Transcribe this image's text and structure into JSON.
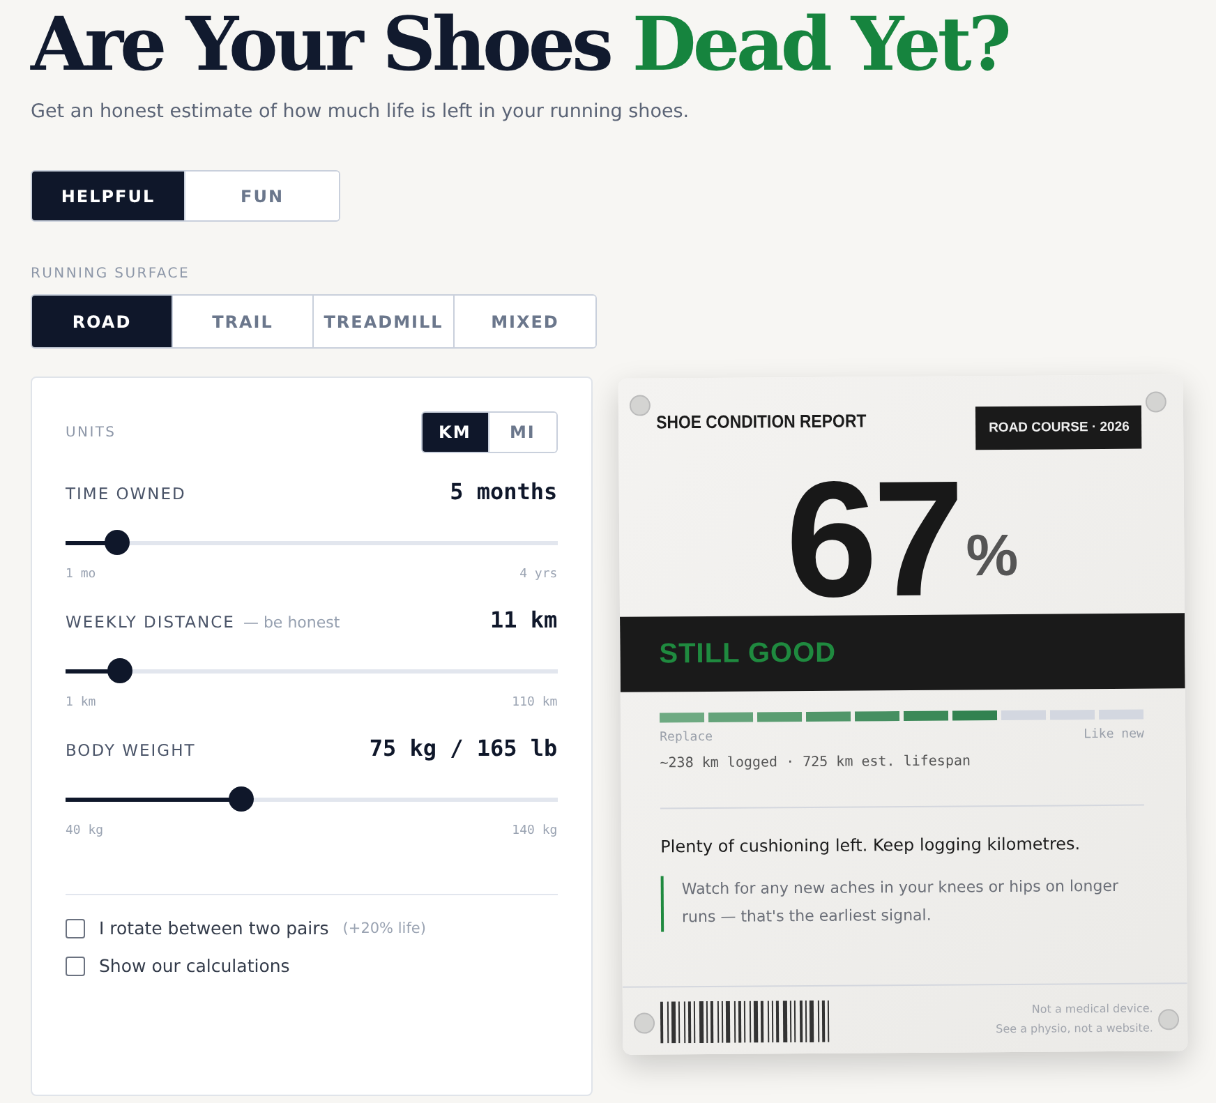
{
  "title": {
    "main": "Are Your Shoes",
    "accent": "Dead Yet?"
  },
  "subtitle": "Get an honest estimate of how much life is left in your running shoes.",
  "modes": [
    {
      "label": "HELPFUL",
      "selected": true
    },
    {
      "label": "FUN",
      "selected": false
    }
  ],
  "surface": {
    "label": "RUNNING SURFACE",
    "options": [
      {
        "label": "ROAD",
        "selected": true
      },
      {
        "label": "TRAIL",
        "selected": false
      },
      {
        "label": "TREADMILL",
        "selected": false
      },
      {
        "label": "MIXED",
        "selected": false
      }
    ]
  },
  "units": {
    "label": "UNITS",
    "options": [
      {
        "label": "KM",
        "selected": true
      },
      {
        "label": "MI",
        "selected": false
      }
    ]
  },
  "sliders": [
    {
      "label": "TIME OWNED",
      "value": "5 months",
      "level": 0.104,
      "min": "1 mo",
      "max": "4 yrs"
    },
    {
      "label": "WEEKLY DISTANCE",
      "note": "— be honest",
      "value": "11 km",
      "level": 0.112,
      "min": "1 km",
      "max": "110 km"
    },
    {
      "label": "BODY WEIGHT",
      "value": "75 kg / 165 lb",
      "level": 0.357,
      "min": "40 kg",
      "max": "140 kg"
    }
  ],
  "options": [
    {
      "label": "I rotate between two pairs",
      "note": "(+20% life)",
      "checked": false
    },
    {
      "label": "Show our calculations",
      "checked": false
    }
  ],
  "report": {
    "title": "SHOE CONDITION REPORT",
    "tag": "ROAD COURSE · 2026",
    "percent": "67",
    "percent_sign": "%",
    "verdict": "STILL GOOD",
    "meter": {
      "level": 0.7,
      "min": "Replace",
      "max": "Like new"
    },
    "logged": "~238 km logged · 725 km est. lifespan",
    "summary": "Plenty of cushioning left. Keep logging kilometres.",
    "tip": "Watch for any new aches in your knees or hips on longer runs — that's the earliest signal.",
    "disclaimer": [
      "Not a medical device.",
      "See a physio, not a website."
    ]
  }
}
